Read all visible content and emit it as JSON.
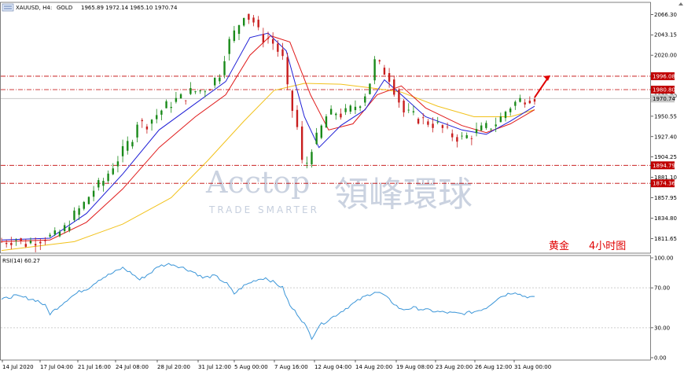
{
  "header": {
    "symbol": "XAUUSD, H4:",
    "name": "GOLD",
    "ohlc": "1965.89 1972.14 1965.10 1970.74"
  },
  "watermark": {
    "brand": "Acctop",
    "tagline": "TRADE SMARTER",
    "cn": "領峰環球"
  },
  "caption": {
    "name": "黄金",
    "period": "4小时图"
  },
  "colors": {
    "bull": "#1a8a1a",
    "bear": "#c81e1e",
    "ma_fast": "#1f1fd6",
    "ma_mid": "#e01b1b",
    "ma_slow": "#f2c21b",
    "level": "#c00000",
    "rsi": "#3c96d8",
    "arrow": "#e00000"
  },
  "chart_data": [
    {
      "type": "candlestick",
      "title": "XAUUSD, H4: GOLD",
      "ylim": [
        1795,
        2080
      ],
      "y_ticks": [
        "2066.30",
        "2043.15",
        "2020.00",
        "1973.70",
        "1950.55",
        "1927.40",
        "1904.25",
        "1881.10",
        "1857.95",
        "1834.80",
        "1811.65"
      ],
      "x_ticks": [
        "14 Jul 2020",
        "17 Jul 04:00",
        "21 Jul 16:00",
        "24 Jul 08:00",
        "28 Jul 20:00",
        "31 Jul 12:00",
        "5 Aug 00:00",
        "7 Aug 16:00",
        "12 Aug 04:00",
        "14 Aug 20:00",
        "19 Aug 08:00",
        "23 Aug 20:00",
        "26 Aug 12:00",
        "31 Aug 00:00"
      ],
      "levels": [
        {
          "label": "1996.08",
          "value": 1996.08
        },
        {
          "label": "1980.80",
          "value": 1980.8
        },
        {
          "label": "1894.79",
          "value": 1894.79
        },
        {
          "label": "1874.36",
          "value": 1874.36
        }
      ],
      "current_price": {
        "label": "1970.74",
        "value": 1970.74
      },
      "close_path": [
        [
          0,
          1808
        ],
        [
          12,
          1811
        ],
        [
          18,
          1805
        ],
        [
          28,
          1810
        ],
        [
          36,
          1813
        ],
        [
          44,
          1814
        ],
        [
          52,
          1823
        ],
        [
          60,
          1838
        ],
        [
          68,
          1851
        ],
        [
          75,
          1866
        ],
        [
          83,
          1875
        ],
        [
          92,
          1895
        ],
        [
          100,
          1910
        ],
        [
          108,
          1928
        ],
        [
          112,
          1945
        ],
        [
          118,
          1940
        ],
        [
          126,
          1950
        ],
        [
          134,
          1960
        ],
        [
          142,
          1968
        ],
        [
          150,
          1972
        ],
        [
          156,
          1978
        ],
        [
          164,
          1980
        ],
        [
          172,
          1985
        ],
        [
          180,
          2000
        ],
        [
          186,
          2030
        ],
        [
          194,
          2050
        ],
        [
          200,
          2068
        ],
        [
          208,
          2058
        ],
        [
          214,
          2040
        ],
        [
          222,
          2038
        ],
        [
          228,
          2025
        ],
        [
          234,
          2010
        ],
        [
          238,
          1950
        ],
        [
          242,
          1965
        ],
        [
          246,
          1910
        ],
        [
          250,
          1885
        ],
        [
          254,
          1912
        ],
        [
          260,
          1925
        ],
        [
          268,
          1950
        ],
        [
          276,
          1955
        ],
        [
          282,
          1952
        ],
        [
          290,
          1960
        ],
        [
          298,
          1970
        ],
        [
          304,
          1990
        ],
        [
          308,
          2012
        ],
        [
          314,
          2005
        ],
        [
          320,
          1995
        ],
        [
          326,
          1975
        ],
        [
          332,
          1955
        ],
        [
          340,
          1950
        ],
        [
          350,
          1945
        ],
        [
          360,
          1940
        ],
        [
          370,
          1930
        ],
        [
          380,
          1925
        ],
        [
          388,
          1930
        ],
        [
          396,
          1935
        ],
        [
          404,
          1940
        ],
        [
          410,
          1945
        ],
        [
          418,
          1960
        ],
        [
          426,
          1968
        ],
        [
          434,
          1972
        ],
        [
          440,
          1973
        ]
      ],
      "ma_fast": [
        [
          0,
          1810
        ],
        [
          40,
          1812
        ],
        [
          70,
          1840
        ],
        [
          100,
          1885
        ],
        [
          130,
          1935
        ],
        [
          160,
          1965
        ],
        [
          185,
          1990
        ],
        [
          205,
          2040
        ],
        [
          220,
          2045
        ],
        [
          235,
          2025
        ],
        [
          250,
          1950
        ],
        [
          262,
          1915
        ],
        [
          280,
          1940
        ],
        [
          300,
          1958
        ],
        [
          316,
          1992
        ],
        [
          330,
          1975
        ],
        [
          350,
          1950
        ],
        [
          380,
          1935
        ],
        [
          400,
          1930
        ],
        [
          420,
          1945
        ],
        [
          440,
          1962
        ]
      ],
      "ma_mid": [
        [
          0,
          1808
        ],
        [
          40,
          1810
        ],
        [
          70,
          1830
        ],
        [
          100,
          1868
        ],
        [
          130,
          1915
        ],
        [
          160,
          1950
        ],
        [
          185,
          1975
        ],
        [
          205,
          2020
        ],
        [
          222,
          2042
        ],
        [
          238,
          2035
        ],
        [
          255,
          1975
        ],
        [
          270,
          1935
        ],
        [
          290,
          1942
        ],
        [
          310,
          1975
        ],
        [
          330,
          1985
        ],
        [
          350,
          1960
        ],
        [
          380,
          1940
        ],
        [
          400,
          1932
        ],
        [
          420,
          1942
        ],
        [
          440,
          1958
        ]
      ],
      "ma_slow": [
        [
          0,
          1798
        ],
        [
          60,
          1808
        ],
        [
          100,
          1828
        ],
        [
          140,
          1858
        ],
        [
          170,
          1900
        ],
        [
          200,
          1945
        ],
        [
          225,
          1980
        ],
        [
          250,
          1988
        ],
        [
          280,
          1987
        ],
        [
          310,
          1982
        ],
        [
          330,
          1978
        ],
        [
          360,
          1962
        ],
        [
          390,
          1950
        ],
        [
          420,
          1950
        ],
        [
          440,
          1958
        ]
      ]
    },
    {
      "type": "line",
      "title": "RSI(14) 60.27",
      "ylim": [
        0,
        100
      ],
      "y_ticks": [
        "100.00",
        "70.00",
        "30.00",
        "0.00"
      ],
      "levels": [
        {
          "label": "70.00",
          "value": 70
        },
        {
          "label": "30.00",
          "value": 30
        }
      ],
      "series": [
        {
          "name": "RSI(14)",
          "values": [
            [
              0,
              58
            ],
            [
              10,
              62
            ],
            [
              20,
              60
            ],
            [
              30,
              57
            ],
            [
              36,
              52
            ],
            [
              40,
              44
            ],
            [
              46,
              50
            ],
            [
              56,
              60
            ],
            [
              64,
              66
            ],
            [
              72,
              70
            ],
            [
              80,
              78
            ],
            [
              92,
              85
            ],
            [
              100,
              90
            ],
            [
              108,
              84
            ],
            [
              114,
              78
            ],
            [
              124,
              86
            ],
            [
              130,
              92
            ],
            [
              140,
              94
            ],
            [
              150,
              90
            ],
            [
              160,
              85
            ],
            [
              166,
              80
            ],
            [
              176,
              82
            ],
            [
              186,
              74
            ],
            [
              192,
              64
            ],
            [
              200,
              72
            ],
            [
              210,
              78
            ],
            [
              218,
              80
            ],
            [
              224,
              76
            ],
            [
              232,
              70
            ],
            [
              238,
              52
            ],
            [
              244,
              44
            ],
            [
              250,
              34
            ],
            [
              256,
              20
            ],
            [
              262,
              32
            ],
            [
              270,
              38
            ],
            [
              280,
              46
            ],
            [
              290,
              54
            ],
            [
              298,
              60
            ],
            [
              308,
              66
            ],
            [
              314,
              64
            ],
            [
              322,
              56
            ],
            [
              330,
              48
            ],
            [
              340,
              50
            ],
            [
              350,
              48
            ],
            [
              360,
              46
            ],
            [
              370,
              45
            ],
            [
              380,
              44
            ],
            [
              390,
              46
            ],
            [
              400,
              50
            ],
            [
              410,
              60
            ],
            [
              418,
              64
            ],
            [
              424,
              66
            ],
            [
              430,
              62
            ],
            [
              440,
              60
            ]
          ]
        }
      ]
    }
  ]
}
